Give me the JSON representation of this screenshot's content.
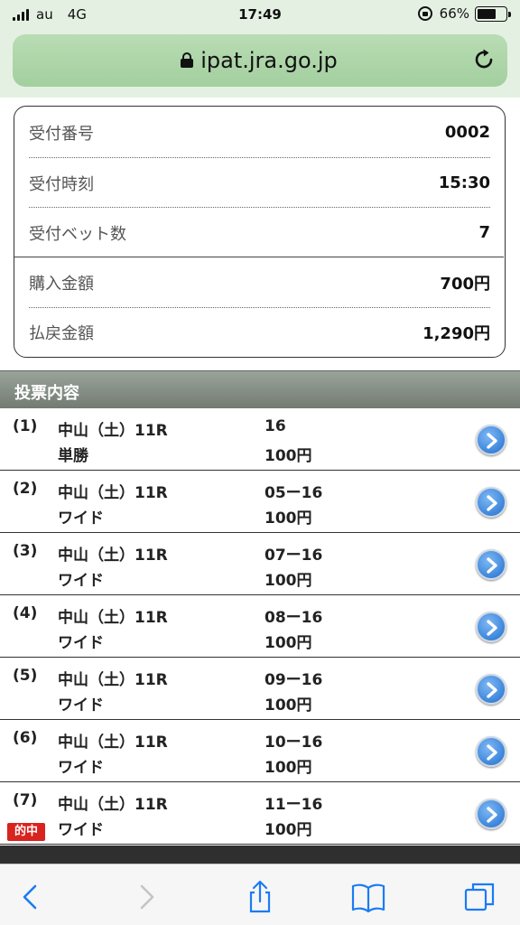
{
  "status_bar": {
    "carrier": "au",
    "network": "4G",
    "time": "17:49",
    "battery": "66%",
    "battery_level": 0.66
  },
  "browser": {
    "url": "ipat.jra.go.jp"
  },
  "receipt": {
    "rows": [
      {
        "label": "受付番号",
        "value": "0002"
      },
      {
        "label": "受付時刻",
        "value": "15:30"
      },
      {
        "label": "受付ベット数",
        "value": "7"
      },
      {
        "label": "購入金額",
        "value": "700円"
      },
      {
        "label": "払戻金額",
        "value": "1,290円"
      }
    ]
  },
  "section": {
    "title": "投票内容"
  },
  "bets": [
    {
      "num": "(1)",
      "race": "中山（土）11R",
      "type": "単勝",
      "horses": "16",
      "amount": "100円",
      "hit": ""
    },
    {
      "num": "(2)",
      "race": "中山（土）11R",
      "type": "ワイド",
      "horses": "05ー16",
      "amount": "100円",
      "hit": ""
    },
    {
      "num": "(3)",
      "race": "中山（土）11R",
      "type": "ワイド",
      "horses": "07ー16",
      "amount": "100円",
      "hit": ""
    },
    {
      "num": "(4)",
      "race": "中山（土）11R",
      "type": "ワイド",
      "horses": "08ー16",
      "amount": "100円",
      "hit": ""
    },
    {
      "num": "(5)",
      "race": "中山（土）11R",
      "type": "ワイド",
      "horses": "09ー16",
      "amount": "100円",
      "hit": ""
    },
    {
      "num": "(6)",
      "race": "中山（土）11R",
      "type": "ワイド",
      "horses": "10ー16",
      "amount": "100円",
      "hit": ""
    },
    {
      "num": "(7)",
      "race": "中山（土）11R",
      "type": "ワイド",
      "horses": "11ー16",
      "amount": "100円",
      "hit": "的中"
    }
  ],
  "toolbar": {
    "icons": [
      "back-icon",
      "forward-icon",
      "share-icon",
      "bookmarks-icon",
      "tabs-icon"
    ]
  },
  "colors": {
    "browser_chrome": "#e4f1e2",
    "url_field": "#a3cf9e",
    "hit_badge": "#d9231e",
    "arrow_button": "#1f6fd0",
    "toolbar_icon": "#1a7cf5"
  }
}
